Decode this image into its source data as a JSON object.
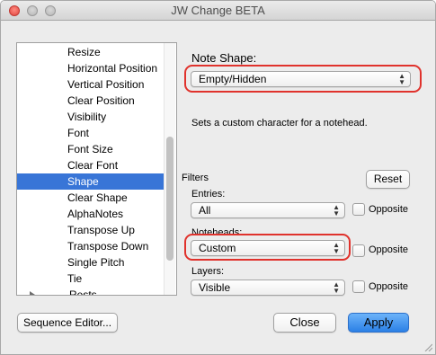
{
  "window": {
    "title": "JW Change BETA"
  },
  "list": {
    "items": [
      {
        "label": "Resize"
      },
      {
        "label": "Horizontal Position"
      },
      {
        "label": "Vertical Position"
      },
      {
        "label": "Clear Position"
      },
      {
        "label": "Visibility"
      },
      {
        "label": "Font"
      },
      {
        "label": "Font Size"
      },
      {
        "label": "Clear Font"
      },
      {
        "label": "Shape",
        "selected": true
      },
      {
        "label": "Clear Shape"
      },
      {
        "label": "AlphaNotes"
      },
      {
        "label": "Transpose Up"
      },
      {
        "label": "Transpose Down"
      },
      {
        "label": "Single Pitch"
      },
      {
        "label": "Tie"
      },
      {
        "label": "Rests",
        "group": true
      }
    ],
    "selected_label": "Shape"
  },
  "note_shape": {
    "heading": "Note Shape:",
    "value": "Empty/Hidden",
    "description": "Sets a custom character for a notehead."
  },
  "filters": {
    "label": "Filters",
    "reset_label": "Reset",
    "entries": {
      "label": "Entries:",
      "value": "All",
      "opposite_label": "Opposite"
    },
    "noteheads": {
      "label": "Noteheads:",
      "value": "Custom",
      "opposite_label": "Opposite"
    },
    "layers": {
      "label": "Layers:",
      "value": "Visible",
      "opposite_label": "Opposite"
    }
  },
  "buttons": {
    "sequence_editor": "Sequence Editor...",
    "close": "Close",
    "apply": "Apply"
  },
  "colors": {
    "selection": "#3875d7",
    "highlight_ring": "#e0322c",
    "apply_button": "#2b80e6",
    "close_traffic_light": "#e0443e"
  }
}
